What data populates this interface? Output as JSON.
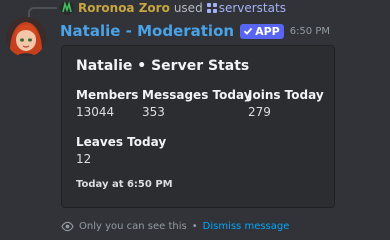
{
  "reply": {
    "user_name": "Roronoa Zoro",
    "used_text": "used",
    "command": "serverstats"
  },
  "message": {
    "bot_name": "Natalie - Moderation",
    "app_badge": "APP",
    "timestamp": "6:50 PM"
  },
  "embed": {
    "title": "Natalie • Server Stats",
    "fields": [
      {
        "name": "Members",
        "value": "13044"
      },
      {
        "name": "Messages Today",
        "value": "353"
      },
      {
        "name": "Joins Today",
        "value": "279"
      },
      {
        "name": "Leaves Today",
        "value": "12"
      }
    ],
    "footer": "Today at 6:50 PM"
  },
  "ephemeral": {
    "notice": "Only you can see this",
    "separator": "•",
    "dismiss_label": "Dismiss message"
  },
  "colors": {
    "background": "#313338",
    "embed_background": "#2b2d31",
    "bot_name": "#4aa3e8",
    "app_badge": "#5865f2",
    "link": "#00a8fc",
    "reply_user": "#c7a53f"
  }
}
